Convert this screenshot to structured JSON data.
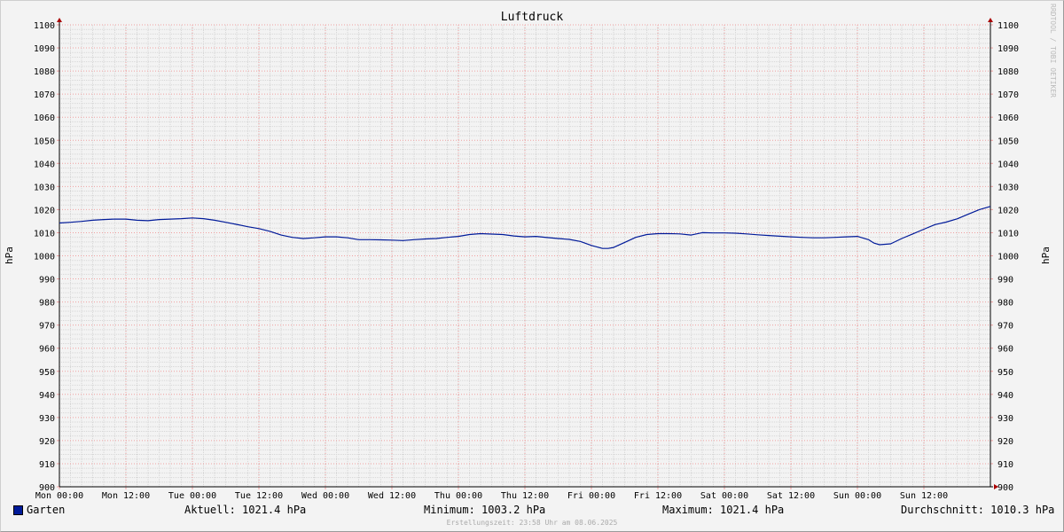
{
  "chart_data": {
    "type": "line",
    "title": "Luftdruck",
    "ylabel_left": "hPa",
    "ylabel_right": "hPa",
    "ylim": [
      900,
      1100
    ],
    "ytick_step": 10,
    "yminor_step": 2,
    "xlim": [
      0,
      168
    ],
    "xticks": [
      {
        "x": 0,
        "label": "Mon 00:00"
      },
      {
        "x": 12,
        "label": "Mon 12:00"
      },
      {
        "x": 24,
        "label": "Tue 00:00"
      },
      {
        "x": 36,
        "label": "Tue 12:00"
      },
      {
        "x": 48,
        "label": "Wed 00:00"
      },
      {
        "x": 60,
        "label": "Wed 12:00"
      },
      {
        "x": 72,
        "label": "Thu 00:00"
      },
      {
        "x": 84,
        "label": "Thu 12:00"
      },
      {
        "x": 96,
        "label": "Fri 00:00"
      },
      {
        "x": 108,
        "label": "Fri 12:00"
      },
      {
        "x": 120,
        "label": "Sat 00:00"
      },
      {
        "x": 132,
        "label": "Sat 12:00"
      },
      {
        "x": 144,
        "label": "Sun 00:00"
      },
      {
        "x": 156,
        "label": "Sun 12:00"
      }
    ],
    "xminor_step": 2,
    "grid": true,
    "colors": {
      "line": "#001a99",
      "major_grid": "#f0a0a0",
      "minor_grid": "#d6d6d6",
      "axis": "#000000",
      "arrow": "#aa0000"
    },
    "series": [
      {
        "name": "Garten",
        "x": [
          0,
          2,
          4,
          6,
          8,
          10,
          12,
          14,
          16,
          18,
          20,
          22,
          24,
          26,
          28,
          30,
          32,
          34,
          36,
          38,
          40,
          42,
          44,
          46,
          48,
          50,
          52,
          54,
          56,
          58,
          60,
          62,
          64,
          66,
          68,
          70,
          72,
          74,
          76,
          78,
          80,
          82,
          84,
          86,
          88,
          90,
          92,
          94,
          96,
          98,
          99,
          100,
          102,
          104,
          106,
          108,
          110,
          112,
          114,
          116,
          118,
          120,
          122,
          124,
          126,
          128,
          130,
          132,
          134,
          136,
          138,
          140,
          142,
          144,
          146,
          147,
          148,
          150,
          152,
          154,
          156,
          158,
          160,
          162,
          164,
          166,
          168
        ],
        "values": [
          1014.2,
          1014.5,
          1014.9,
          1015.4,
          1015.7,
          1015.9,
          1015.9,
          1015.4,
          1015.2,
          1015.7,
          1015.9,
          1016.1,
          1016.4,
          1016.1,
          1015.4,
          1014.5,
          1013.6,
          1012.6,
          1011.8,
          1010.6,
          1009.0,
          1008.0,
          1007.5,
          1007.8,
          1008.2,
          1008.2,
          1007.8,
          1007.0,
          1007.0,
          1006.9,
          1006.8,
          1006.6,
          1007.0,
          1007.3,
          1007.5,
          1008.0,
          1008.4,
          1009.2,
          1009.6,
          1009.4,
          1009.2,
          1008.6,
          1008.2,
          1008.4,
          1007.9,
          1007.5,
          1007.1,
          1006.2,
          1004.5,
          1003.2,
          1003.2,
          1003.6,
          1005.8,
          1008.0,
          1009.2,
          1009.6,
          1009.6,
          1009.5,
          1009.0,
          1010.0,
          1009.9,
          1009.9,
          1009.8,
          1009.5,
          1009.1,
          1008.8,
          1008.5,
          1008.2,
          1008.0,
          1007.8,
          1007.8,
          1008.0,
          1008.2,
          1008.4,
          1007.0,
          1005.5,
          1004.8,
          1005.2,
          1007.5,
          1009.5,
          1011.5,
          1013.5,
          1014.6,
          1016.0,
          1018.0,
          1020.0,
          1021.4
        ]
      }
    ]
  },
  "legend": {
    "series_label": "Garten",
    "aktuell": "Aktuell: 1021.4 hPa",
    "minimum": "Minimum: 1003.2 hPa",
    "maximum": "Maximum: 1021.4 hPa",
    "durchschnitt": "Durchschnitt: 1010.3 hPa"
  },
  "footer": "Erstellungszeit: 23:58 Uhr am 08.06.2025",
  "watermark": "RRDTOOL / TOBI OETIKER"
}
